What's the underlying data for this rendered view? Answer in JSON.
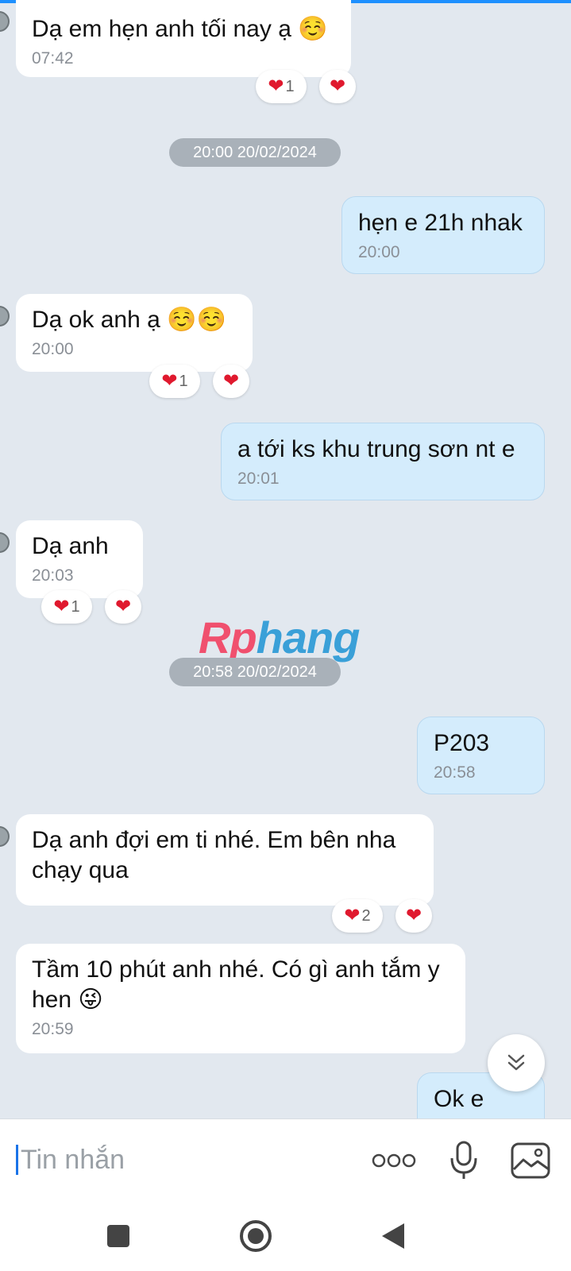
{
  "messages": [
    {
      "text": "Dạ em hẹn anh tối nay ạ ☺️",
      "time": "07:42",
      "reaction_count": "1"
    },
    {
      "date": "20:00 20/02/2024"
    },
    {
      "text": "hẹn e 21h nhak",
      "time": "20:00"
    },
    {
      "text": "Dạ ok anh ạ ☺️☺️",
      "time": "20:00",
      "reaction_count": "1"
    },
    {
      "text": "a tới ks khu trung sơn nt e",
      "time": "20:01"
    },
    {
      "text": "Dạ anh",
      "time": "20:03",
      "reaction_count": "1"
    },
    {
      "date": "20:58 20/02/2024"
    },
    {
      "text": "P203",
      "time": "20:58"
    },
    {
      "text": "Dạ anh đợi em ti nhé. Em bên nha chạy qua",
      "reaction_count": "2"
    },
    {
      "text": "Tầm 10 phút anh nhé. Có gì anh tắm y hen 😜",
      "time": "20:59"
    },
    {
      "text": "Ok e"
    }
  ],
  "watermark": {
    "part1": "Rp",
    "part2": "hang"
  },
  "composer": {
    "placeholder": "Tin nhắn"
  },
  "icons": {
    "reaction": "heart-icon",
    "scroll": "chevron-double-down-icon",
    "more": "more-dots-icon",
    "mic": "microphone-icon",
    "image": "image-icon",
    "nav": [
      "square-icon",
      "circle-icon",
      "back-triangle-icon"
    ]
  },
  "colors": {
    "incoming": "#ffffff",
    "outgoing": "#d4ecfc",
    "heart": "#e0192e",
    "background": "#e2e8ef"
  }
}
